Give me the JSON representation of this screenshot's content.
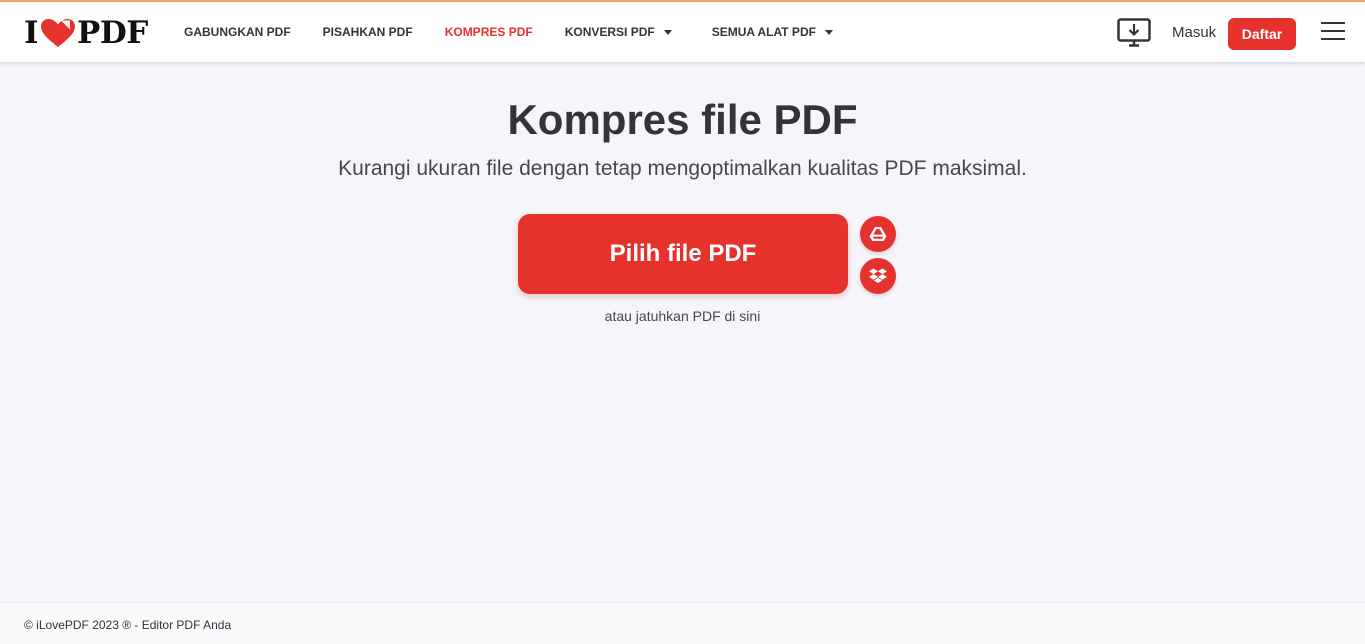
{
  "header": {
    "logo": {
      "left": "I",
      "right": "PDF"
    },
    "nav": [
      {
        "label": "GABUNGKAN PDF",
        "active": false,
        "dropdown": false
      },
      {
        "label": "PISAHKAN PDF",
        "active": false,
        "dropdown": false
      },
      {
        "label": "KOMPRES PDF",
        "active": true,
        "dropdown": false
      },
      {
        "label": "KONVERSI PDF",
        "active": false,
        "dropdown": true
      },
      {
        "label": "SEMUA ALAT PDF",
        "active": false,
        "dropdown": true
      }
    ],
    "desktop_icon": "desktop-download-icon",
    "login_label": "Masuk",
    "signup_label": "Daftar",
    "menu_icon": "hamburger-menu-icon"
  },
  "main": {
    "title": "Kompres file PDF",
    "subtitle": "Kurangi ukuran file dengan tetap mengoptimalkan kualitas PDF maksimal.",
    "select_button_label": "Pilih file PDF",
    "cloud_buttons": [
      "google-drive-icon",
      "dropbox-icon"
    ],
    "drop_hint": "atau jatuhkan PDF di sini"
  },
  "footer": {
    "text": "© iLovePDF 2023 ® - Editor PDF Anda"
  },
  "colors": {
    "accent": "#e5322d",
    "text": "#33333b",
    "background": "#f5f5fa",
    "top_border": "#f0a56b"
  }
}
